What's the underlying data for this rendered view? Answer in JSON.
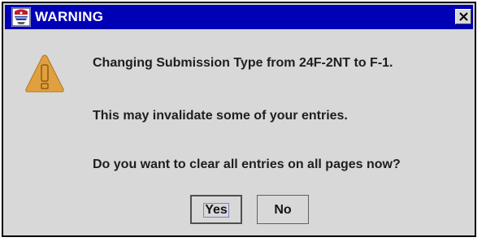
{
  "window": {
    "title": "WARNING",
    "title_icon": "app-logo-icon",
    "close_icon": "close-icon"
  },
  "dialog": {
    "icon": "warning-icon",
    "messages": [
      "Changing Submission Type from 24F-2NT to F-1.",
      "This may invalidate some of your entries.",
      "Do you want to clear all entries on all pages now?"
    ]
  },
  "buttons": {
    "yes_label": "Yes",
    "no_label": "No"
  },
  "colors": {
    "titlebar": "#0000b4",
    "dialog_bg": "#d8d8d8",
    "warning_fill": "#e0a040"
  }
}
